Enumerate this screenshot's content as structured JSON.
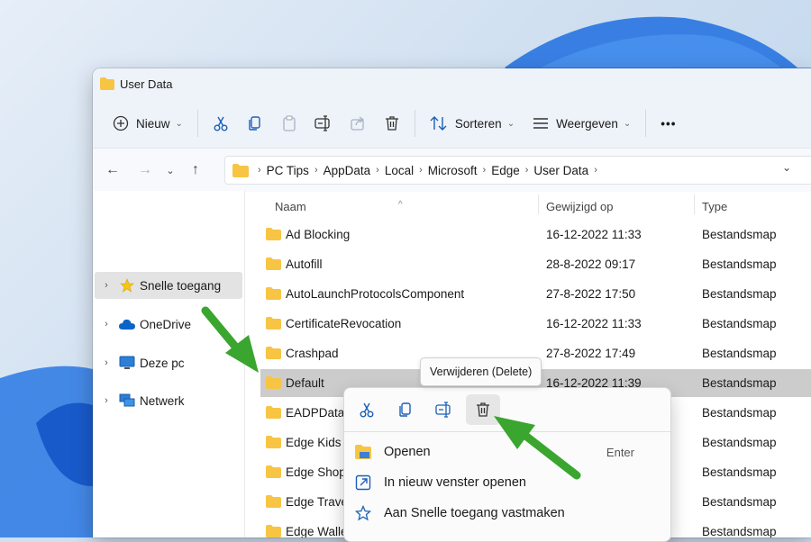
{
  "window": {
    "title": "User Data"
  },
  "toolbar": {
    "new_label": "Nieuw",
    "sort_label": "Sorteren",
    "view_label": "Weergeven",
    "more_label": "•••"
  },
  "address": {
    "crumbs": [
      "PC Tips",
      "AppData",
      "Local",
      "Microsoft",
      "Edge",
      "User Data"
    ]
  },
  "sidebar": {
    "items": [
      {
        "label": "Snelle toegang",
        "icon": "star-icon",
        "selected": true
      },
      {
        "label": "OneDrive",
        "icon": "cloud-icon"
      },
      {
        "label": "Deze pc",
        "icon": "monitor-icon"
      },
      {
        "label": "Netwerk",
        "icon": "network-icon"
      }
    ]
  },
  "columns": {
    "name": "Naam",
    "modified": "Gewijzigd op",
    "type": "Type"
  },
  "files": [
    {
      "name": "Ad Blocking",
      "modified": "16-12-2022 11:33",
      "type": "Bestandsmap"
    },
    {
      "name": "Autofill",
      "modified": "28-8-2022 09:17",
      "type": "Bestandsmap"
    },
    {
      "name": "AutoLaunchProtocolsComponent",
      "modified": "27-8-2022 17:50",
      "type": "Bestandsmap"
    },
    {
      "name": "CertificateRevocation",
      "modified": "16-12-2022 11:33",
      "type": "Bestandsmap"
    },
    {
      "name": "Crashpad",
      "modified": "27-8-2022 17:49",
      "type": "Bestandsmap"
    },
    {
      "name": "Default",
      "modified": "16-12-2022 11:39",
      "type": "Bestandsmap",
      "selected": true
    },
    {
      "name": "EADPData C",
      "modified": "",
      "type": "Bestandsmap"
    },
    {
      "name": "Edge Kids M",
      "modified": "",
      "type": "Bestandsmap"
    },
    {
      "name": "Edge Shopp",
      "modified": "",
      "type": "Bestandsmap"
    },
    {
      "name": "Edge Travel",
      "modified": "",
      "type": "Bestandsmap"
    },
    {
      "name": "Edge Wallet",
      "modified": "",
      "type": "Bestandsmap"
    }
  ],
  "tooltip": {
    "text": "Verwijderen (Delete)"
  },
  "context_menu": {
    "items": [
      {
        "label": "Openen",
        "shortcut": "Enter"
      },
      {
        "label": "In nieuw venster openen",
        "shortcut": ""
      },
      {
        "label": "Aan Snelle toegang vastmaken",
        "shortcut": ""
      }
    ]
  },
  "colors": {
    "accent": "#0067c0",
    "folder": "#f7c444",
    "arrow": "#3aa52f",
    "selection": "#cccccc"
  }
}
